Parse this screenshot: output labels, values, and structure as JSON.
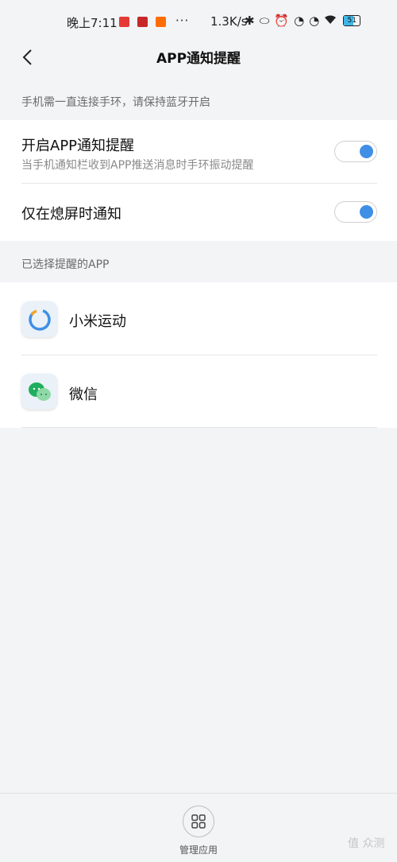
{
  "status_bar": {
    "time": "晚上7:11",
    "dots": "···",
    "network_speed": "1.3K/s",
    "battery_level": "51"
  },
  "header": {
    "title": "APP通知提醒"
  },
  "hint_top": "手机需一直连接手环，请保持蓝牙开启",
  "settings": {
    "app_notify": {
      "title": "开启APP通知提醒",
      "subtitle": "当手机通知栏收到APP推送消息时手环振动提醒",
      "enabled": true
    },
    "screen_off_only": {
      "title": "仅在熄屏时通知",
      "enabled": true
    }
  },
  "selected_apps_label": "已选择提醒的APP",
  "apps": [
    {
      "name": "小米运动",
      "icon": "mi-fit-ring-icon"
    },
    {
      "name": "微信",
      "icon": "wechat-icon"
    }
  ],
  "bottom": {
    "manage_label": "管理应用",
    "manage_icon": "grid-icon"
  },
  "watermark": "值 众测",
  "colors": {
    "accent": "#3f8fe6",
    "background": "#f3f4f6"
  }
}
